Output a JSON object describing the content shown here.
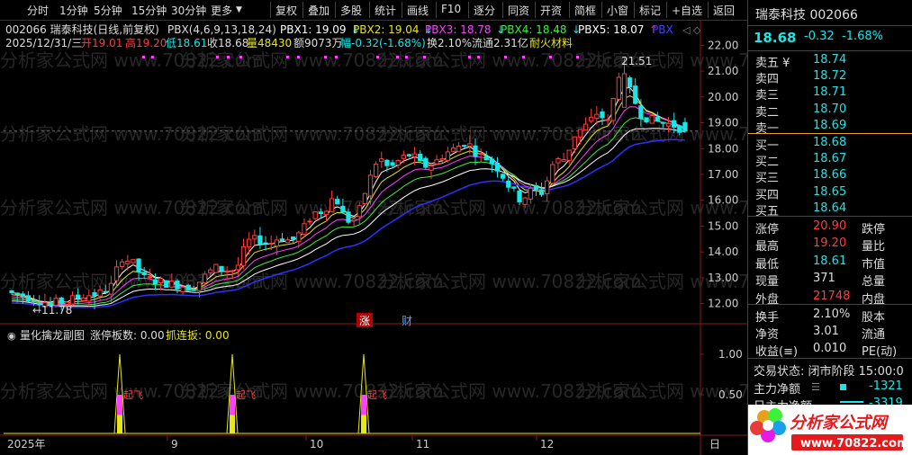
{
  "toolbar": {
    "period_items": [
      "分时",
      "1分钟",
      "5分钟",
      "15分钟",
      "30分钟",
      "更多"
    ],
    "func_items": [
      "复权",
      "叠加",
      "多股",
      "统计",
      "画线",
      "F10",
      "逐分",
      "同资",
      "开资",
      "简框",
      "小窗",
      "标记",
      "+自选",
      "返回"
    ]
  },
  "info": {
    "stock_title": "002066 瑞泰科技(日线,前复权)",
    "indicator": "PBX(4,6,9,13,18,24)",
    "pbx": [
      {
        "label": "PBX1: 19.09",
        "color": "#ffffff"
      },
      {
        "label": "PBX2: 19.04",
        "color": "#e6e619"
      },
      {
        "label": "PBX3: 18.78",
        "color": "#ff40ff"
      },
      {
        "label": "PBX4: 18.48",
        "color": "#3cf03c"
      },
      {
        "label": "PBX5: 18.07",
        "color": "#ffffff"
      },
      {
        "label": "PBX",
        "color": "#4040ff"
      }
    ],
    "line2": {
      "date": "2025/12/31/三",
      "open": "开19.01",
      "high": "高19.20",
      "low": "低18.61",
      "close": "收18.68",
      "vol": "量48430",
      "amount": "额9073万",
      "change": "幅-0.32(-1.68%)",
      "turnover": "换2.10%",
      "float": "流通2.31亿",
      "sector": "耐火材料"
    }
  },
  "price_axis": {
    "min": 11.5,
    "max": 22.5,
    "ticks": [
      "22.00",
      "21.00",
      "20.00",
      "19.00",
      "18.00",
      "17.00",
      "16.00",
      "15.00",
      "14.00",
      "13.00",
      "12.00"
    ]
  },
  "annotations": {
    "high_label": "21.51",
    "low_label": "←11.78",
    "zhang": "涨",
    "cai": "财"
  },
  "sub_panel": {
    "title": "量化擒龙副图",
    "label1": "涨停板数: 0.00",
    "label2": "抓连扳: 0.00",
    "ticks": [
      "1.00",
      "0.50"
    ],
    "signal_text": "起飞",
    "signal_text_2": "起飞",
    "signal_text_3": "起飞"
  },
  "time_axis": {
    "labels": [
      "2025年",
      "9",
      "10",
      "11",
      "12",
      "日"
    ]
  },
  "watermark": "分析家公式网 www.70822.com",
  "side": {
    "title": "瑞泰科技 002066",
    "price": "18.68",
    "chg": "-0.32",
    "pct": "-1.68%",
    "asks": [
      {
        "label": "卖五 ¥",
        "price": "18.74"
      },
      {
        "label": "卖四",
        "price": "18.72"
      },
      {
        "label": "卖三",
        "price": "18.71"
      },
      {
        "label": "卖二",
        "price": "18.70"
      },
      {
        "label": "卖一",
        "price": "18.69"
      }
    ],
    "bids": [
      {
        "label": "买一",
        "price": "18.68"
      },
      {
        "label": "买二",
        "price": "18.67"
      },
      {
        "label": "买三",
        "price": "18.66"
      },
      {
        "label": "买四",
        "price": "18.65"
      },
      {
        "label": "买五",
        "price": "18.64"
      }
    ],
    "stats": [
      {
        "l": "涨停",
        "v": "20.90",
        "r": "跌停",
        "vc": "red"
      },
      {
        "l": "最高",
        "v": "19.20",
        "r": "量比",
        "vc": "red"
      },
      {
        "l": "最低",
        "v": "18.61",
        "r": "市值",
        "vc": "cyan"
      },
      {
        "l": "现量",
        "v": "371",
        "r": "总量",
        "vc": "white"
      },
      {
        "l": "外盘",
        "v": "21748",
        "r": "内盘",
        "vc": "red"
      }
    ],
    "stats2": [
      {
        "l": "换手",
        "v": "2.10%",
        "r": "股本"
      },
      {
        "l": "净资",
        "v": "3.01",
        "r": "流通"
      },
      {
        "l": "收益(≡)",
        "v": "0.010",
        "r": "PE(动)"
      }
    ],
    "trade_state": "交易状态: 闭市阶段 15:00:0",
    "main_flow_label": "主力净额",
    "main_flow_value": "-1321",
    "main_flow_label2": "日主力净额",
    "main_flow_value2": "-3319"
  },
  "logo": {
    "text": "分析家公式网",
    "url": "www.70822.com"
  }
}
